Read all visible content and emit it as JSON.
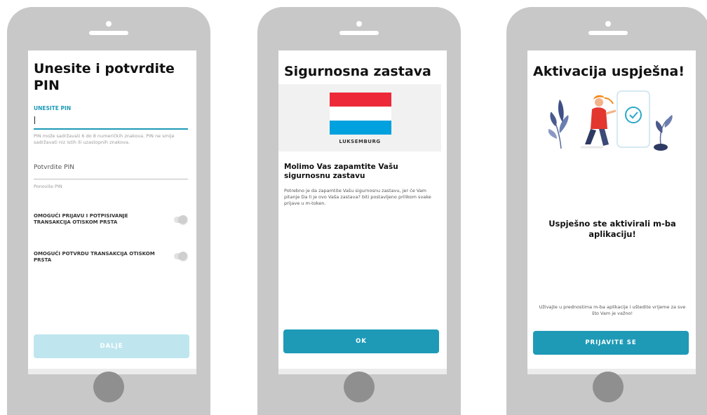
{
  "colors": {
    "accent": "#1e9ab6",
    "accent_disabled": "#bfe6ef",
    "phone_body": "#c8c8c8",
    "flag_red": "#ed2939",
    "flag_white": "#ffffff",
    "flag_blue": "#00a1de"
  },
  "screen1": {
    "title": "Unesite i potvrdite PIN",
    "pin_label": "UNESITE PIN",
    "pin_value": "",
    "pin_hint": "PIN može sadržavati 6 do 8 numeričkih znakova. PIN ne smije sadržavati niz istih ili uzastopnih znakova.",
    "confirm_placeholder": "Potvrdite PIN",
    "confirm_hint": "Ponovite PIN",
    "toggle1_label": "OMOGUĆI PRIJAVU I POTPISIVANJE TRANSAKCIJA OTISKOM PRSTA",
    "toggle2_label": "OMOGUĆI POTVRDU TRANSAKCIJA OTISKOM PRSTA",
    "next_button": "DALJE"
  },
  "screen2": {
    "title": "Sigurnosna zastava",
    "flag_name": "LUKSEMBURG",
    "heading": "Molimo Vas zapamtite Vašu sigurnosnu zastavu",
    "body": "Potrebno je da zapamtite Vašu sigurnosnu zastavu, jer će Vam pitanje Da li je ovo Vaša zastava? biti postavljeno prilikom svake prijave u m-token.",
    "ok_button": "OK"
  },
  "screen3": {
    "title": "Aktivacija uspješna!",
    "message": "Uspješno ste aktivirali m-ba aplikaciju!",
    "footer": "Uživajte u prednostima m-ba aplikacije i uštedite vrijeme za sve što Vam je važno!",
    "login_button": "PRIJAVITE SE"
  }
}
